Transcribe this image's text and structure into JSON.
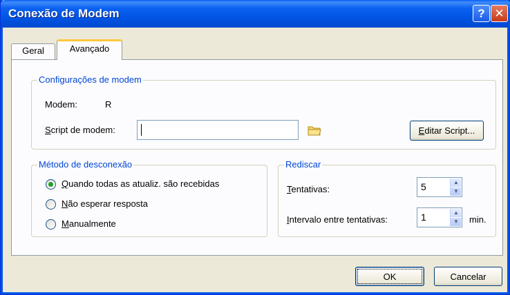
{
  "window": {
    "title": "Conexão de Modem",
    "help_glyph": "?",
    "close_glyph": "✕"
  },
  "tabs": [
    {
      "label": "Geral"
    },
    {
      "label": "Avançado"
    }
  ],
  "config_group": {
    "legend": "Configurações de modem",
    "modem_label": "Modem:",
    "modem_value": "R",
    "script_label_mnemonic": "S",
    "script_label_rest": "cript de modem:",
    "script_value": "",
    "edit_button_mnemonic": "E",
    "edit_button_rest": "ditar Script..."
  },
  "disconnect_group": {
    "legend": "Método de desconexão",
    "options": [
      {
        "mnemonic": "Q",
        "rest": "uando todas as atualiz. são recebidas",
        "checked": true
      },
      {
        "mnemonic": "N",
        "rest": "ão esperar resposta",
        "checked": false
      },
      {
        "mnemonic": "M",
        "rest": "anualmente",
        "checked": false
      }
    ]
  },
  "redial_group": {
    "legend": "Rediscar",
    "attempts_mnemonic": "T",
    "attempts_rest": "entativas:",
    "attempts_value": "5",
    "interval_mnemonic": "I",
    "interval_rest": "ntervalo entre tentativas:",
    "interval_value": "1",
    "interval_unit": "min."
  },
  "footer": {
    "ok_label": "OK",
    "cancel_label": "Cancelar"
  },
  "icons": {
    "folder": "folder-icon",
    "spin_up": "▲",
    "spin_down": "▼"
  }
}
